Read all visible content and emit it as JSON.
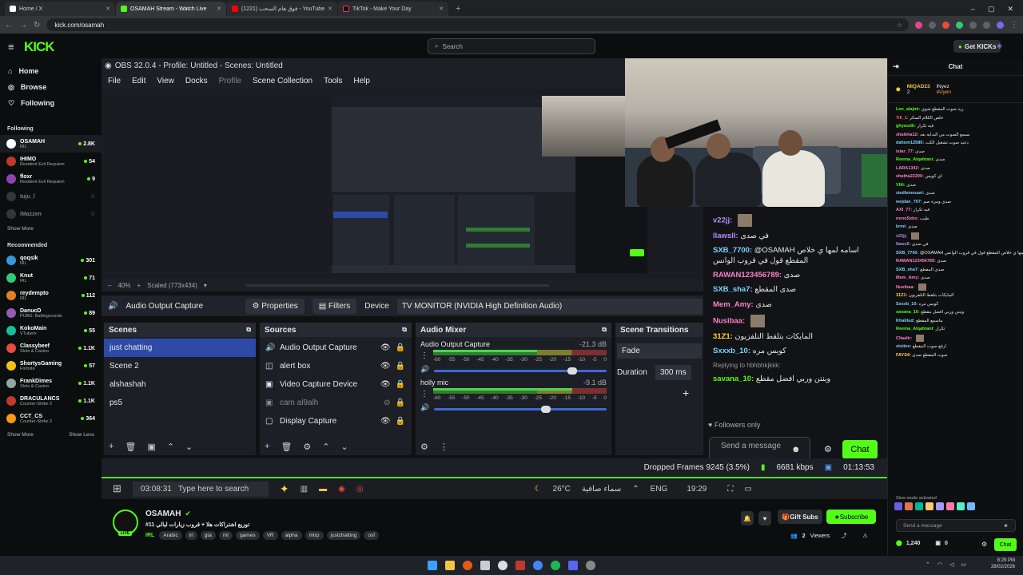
{
  "browser": {
    "tabs": [
      {
        "label": "Home / X",
        "active": false
      },
      {
        "label": "OSAMAH Stream - Watch Live",
        "active": true
      },
      {
        "label": "فوق هام السحب (1221) - YouTube",
        "active": false
      },
      {
        "label": "TikTok - Make Your Day",
        "active": false
      }
    ],
    "url": "kick.com/osamah",
    "get_kicks": "Get KICKs"
  },
  "kick": {
    "logo": "KICK",
    "search_placeholder": "Search",
    "nav": [
      {
        "label": "Home",
        "icon": "home-icon"
      },
      {
        "label": "Browse",
        "icon": "compass-icon"
      },
      {
        "label": "Following",
        "icon": "heart-icon"
      }
    ],
    "following_header": "Following",
    "following": [
      {
        "name": "OSAMAH",
        "game": "IRL",
        "viewers": "2.8K"
      },
      {
        "name": "IHIMO",
        "game": "Resident Evil Requiem",
        "viewers": "54"
      },
      {
        "name": "floxr",
        "game": "Resident Evil Requiem",
        "viewers": "9"
      },
      {
        "name": "tuju_l",
        "game": "",
        "viewers": ""
      },
      {
        "name": "iMazzen",
        "game": "",
        "viewers": ""
      }
    ],
    "show_more": "Show More",
    "recommended_header": "Recommended",
    "recommended": [
      {
        "name": "qoqsik",
        "game": "IRL",
        "viewers": "301"
      },
      {
        "name": "Knut",
        "game": "IRL",
        "viewers": "71"
      },
      {
        "name": "reydempto",
        "game": "IRL",
        "viewers": "112"
      },
      {
        "name": "DanucD",
        "game": "PUBG: Battlegrounds",
        "viewers": "89"
      },
      {
        "name": "KokoMain",
        "game": "VTubers",
        "viewers": "55"
      },
      {
        "name": "Classybeef",
        "game": "Slots & Casino",
        "viewers": "1.1K"
      },
      {
        "name": "ShortysGaming",
        "game": "Fortnite",
        "viewers": "57"
      },
      {
        "name": "FrankDimes",
        "game": "Slots & Casino",
        "viewers": "1.1K"
      },
      {
        "name": "DRACULANCS",
        "game": "Counter-Strike 2",
        "viewers": "1.1K"
      },
      {
        "name": "CCT_CS",
        "game": "Counter-Strike 2",
        "viewers": "364"
      }
    ],
    "show_less": "Show Less"
  },
  "obs": {
    "title": "OBS 32.0.4 - Profile: Untitled - Scenes: Untitled",
    "menu": [
      "File",
      "Edit",
      "View",
      "Docks",
      "Profile",
      "Scene Collection",
      "Tools",
      "Help"
    ],
    "zoom": "40%",
    "scaled": "Scaled (773x434)",
    "source_name": "Audio Output Capture",
    "properties": "Properties",
    "filters": "Filters",
    "device_label": "Device",
    "device_value": "TV MONITOR (NVIDIA High Definition Audio)",
    "scenes_title": "Scenes",
    "scenes": [
      "just chatting",
      "Scene 2",
      "alshashah",
      "ps5"
    ],
    "sources_title": "Sources",
    "sources": [
      "Audio Output Capture",
      "alert box",
      "Video Capture Device",
      "cam al9alh",
      "Display Capture"
    ],
    "mixer_title": "Audio Mixer",
    "mixer": [
      {
        "name": "Audio Output Capture",
        "db": "-21.3 dB",
        "level": 0.6,
        "volume": 0.8
      },
      {
        "name": "holly mic",
        "db": "-9.1 dB",
        "level": 0.8,
        "volume": 0.65
      }
    ],
    "meter_ticks": [
      "-60",
      "-55",
      "-50",
      "-45",
      "-40",
      "-35",
      "-30",
      "-25",
      "-20",
      "-15",
      "-10",
      "-5",
      "0"
    ],
    "transitions_title": "Scene Transitions",
    "transition": "Fade",
    "duration_label": "Duration",
    "duration": "300 ms",
    "dropped": "Dropped Frames 9245 (3.5%)",
    "kbps": "6681 kbps",
    "time": "01:13:53",
    "taskbar_search": "Type here to search",
    "taskbar_time": "03:08:31",
    "weather": "26°C",
    "weather_text": "سماء صافية",
    "lang": "ENG",
    "clock": "19:29"
  },
  "nested_chat": {
    "lines": [
      {
        "user": "v22jj:",
        "msg": "",
        "color": "#b38cff"
      },
      {
        "user": "llawsll:",
        "msg": "في صدى",
        "color": "#b38cff"
      },
      {
        "user": "SXB_7700:",
        "msg": "@OSAMAH اسامه لمها ي خلاص المقطع قول في قروب الوانس",
        "color": "#7fd0ff"
      },
      {
        "user": "RAWAN123456789:",
        "msg": "صدى",
        "color": "#ff7fc8"
      },
      {
        "user": "SXB_sha7:",
        "msg": "صدى المقطع",
        "color": "#7fd0ff"
      },
      {
        "user": "Mem_Amy:",
        "msg": "صدى",
        "color": "#ff7fc8"
      },
      {
        "user": "Nusibaa:",
        "msg": "",
        "color": "#ff7fc8"
      },
      {
        "user": "31Z1:",
        "msg": "المايكات بتلقط التلفزيون",
        "color": "#ffd04d"
      },
      {
        "user": "Sxxxb_10:",
        "msg": "كويس مره",
        "color": "#7fd0ff"
      },
      {
        "user": "savana_10:",
        "msg": "وينتن وربي افضل مقطع",
        "color": "#53fc18"
      }
    ],
    "reply_hint": "Replying to hbhbhkjkkk:",
    "followers_only": "Followers only",
    "send_placeholder": "Send a message",
    "chat_button": "Chat"
  },
  "channel": {
    "name": "OSAMAH",
    "title": "#11 توزيع اشتراكات هلا + قروب زيارات ليالي",
    "category": "IRL",
    "tags": [
      "Arabic",
      "irl",
      "gta",
      "mt",
      "games",
      "VR",
      "alpha",
      "mtrp",
      "justchatting",
      "osf"
    ],
    "gift": "Gift Subs",
    "subscribe": "Subscribe",
    "viewers": "Viewers",
    "viewer_count": "2"
  },
  "chat": {
    "title": "Chat",
    "pinned": [
      {
        "rank": "2",
        "name": "MIQAD23"
      },
      {
        "rank": "1",
        "name": "iNyez"
      },
      {
        "rank": "",
        "name": "lAryen"
      }
    ],
    "messages": [
      {
        "user": "Leo_alajmi:",
        "msg": "زيد صوت المقطع شوي",
        "color": "#53fc18"
      },
      {
        "user": "7ili_1:",
        "msg": "خلص الكلام السكر",
        "color": "#ff6b6b"
      },
      {
        "user": "ghyoudh:",
        "msg": "فيه تكرار",
        "color": "#53fc18"
      },
      {
        "user": "shaikha12:",
        "msg": "نسمع الصوت من البداية بعد",
        "color": "#ff7fc8"
      },
      {
        "user": "dahom12580:",
        "msg": "دعيد صوت تشغيل الكت",
        "color": "#7fd0ff"
      },
      {
        "user": "istar_77:",
        "msg": "صدى",
        "color": "#ff7fc8"
      },
      {
        "user": "Reema_Alqahtani:",
        "msg": "صدى",
        "color": "#53fc18"
      },
      {
        "user": "LARA1342:",
        "msg": "صدى",
        "color": "#ff7fc8"
      },
      {
        "user": "shatha22200:",
        "msg": "اي كويس",
        "color": "#ff7fc8"
      },
      {
        "user": "Vlili:",
        "msg": "صدى",
        "color": "#53fc18"
      },
      {
        "user": "ziedlemouari:",
        "msg": "صدى",
        "color": "#7fd0ff"
      },
      {
        "user": "wejdan_707:",
        "msg": "صدى ومرة صم",
        "color": "#7fd0ff"
      },
      {
        "user": "AXI_77:",
        "msg": "فيه تكرار",
        "color": "#ff7fc8"
      },
      {
        "user": "nonoSxbx:",
        "msg": "طيب",
        "color": "#ff7fc8"
      },
      {
        "user": "krmi:",
        "msg": "صدى",
        "color": "#7fd0ff"
      },
      {
        "user": "v22jj:",
        "msg": "",
        "color": "#b38cff"
      },
      {
        "user": "llawsll:",
        "msg": "في صدى",
        "color": "#b38cff"
      },
      {
        "user": "SXB_7700:",
        "msg": "@OSAMAH اسامه لمها ي خلاص المقطع قول في قروب الوانس",
        "color": "#7fd0ff"
      },
      {
        "user": "RAWAN123456789:",
        "msg": "صدى",
        "color": "#ff7fc8"
      },
      {
        "user": "SXB_sha7:",
        "msg": "صدى المقطع",
        "color": "#7fd0ff"
      },
      {
        "user": "Mem_Amy:",
        "msg": "صدى",
        "color": "#ff7fc8"
      },
      {
        "user": "Nusibaa:",
        "msg": "",
        "color": "#ff7fc8"
      },
      {
        "user": "31Z1:",
        "msg": "المايكات بتلقط التلفزيون",
        "color": "#ffd04d"
      },
      {
        "user": "Sxxxb_10:",
        "msg": "كويس مره",
        "color": "#7fd0ff"
      },
      {
        "user": "savana_10:",
        "msg": "وينتن وربي افضل مقطع",
        "color": "#53fc18"
      },
      {
        "user": "Khalilud:",
        "msg": "ماسمع المقطع",
        "color": "#7fd0ff"
      },
      {
        "user": "Reema_Alqahtani:",
        "msg": "تكرار",
        "color": "#53fc18"
      },
      {
        "user": "Cliaalir:",
        "msg": "",
        "color": "#ff7fc8"
      },
      {
        "user": "stoiiee:",
        "msg": "ارفع صوت المقطع",
        "color": "#7fd0ff"
      },
      {
        "user": "FAYS4:",
        "msg": "صوت المقطع صدى",
        "color": "#ffd04d"
      }
    ],
    "slow_mode": "Slow mode activated",
    "send_placeholder": "Send a message",
    "points": "1,240",
    "zero": "0",
    "chat_button": "Chat"
  },
  "windows": {
    "time": "8:29 PM",
    "date": "28/02/2026"
  },
  "colors": {
    "accent": "#53fc18",
    "obs_select": "#2e4aa6"
  }
}
